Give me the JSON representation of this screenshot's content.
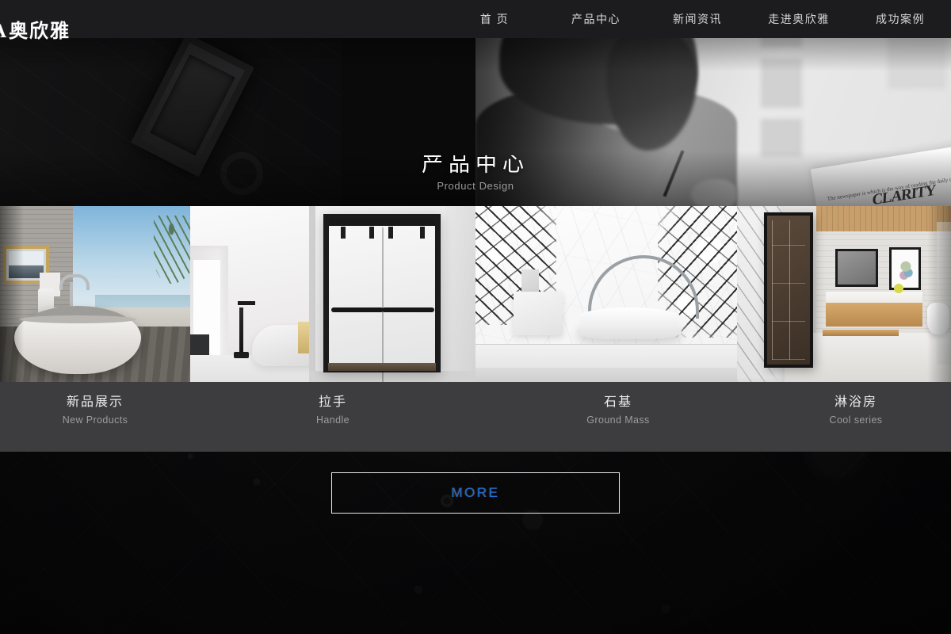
{
  "brand": {
    "mark": "A",
    "name_cn": "奥欣雅"
  },
  "nav": {
    "items": [
      {
        "label": "首 页"
      },
      {
        "label": "产品中心"
      },
      {
        "label": "新闻资讯"
      },
      {
        "label": "走进奥欣雅"
      },
      {
        "label": "成功案例"
      }
    ]
  },
  "hero": {
    "title_cn": "产品中心",
    "title_en": "Product Design"
  },
  "products": {
    "categories": [
      {
        "cn": "新品展示",
        "en": "New Products"
      },
      {
        "cn": "拉手",
        "en": "Handle"
      },
      {
        "cn": "石基",
        "en": "Ground Mass"
      },
      {
        "cn": "淋浴房",
        "en": "Cool series"
      }
    ]
  },
  "more_button": {
    "label": "MORE"
  },
  "colors": {
    "nav_bg": "#1c1c1f",
    "page_bg": "#0a0a0b",
    "label_bar_bg": "#3d3d3f",
    "accent_link": "#1f6fd0",
    "title_text": "#ffffff",
    "subtitle_text": "#9b9b9b"
  }
}
